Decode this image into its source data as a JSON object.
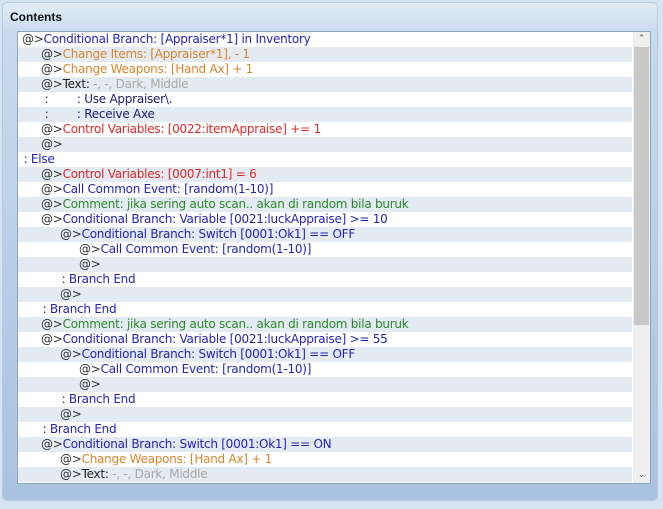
{
  "panel": {
    "title": "Contents"
  },
  "scrollbar": {
    "up_icon": "▲",
    "down_icon": "▼",
    "up_glyph": "⌃",
    "down_glyph": "⌄",
    "position_fraction": 0.0,
    "visible_fraction": 0.66
  },
  "rows": [
    {
      "level": 0,
      "prefix": "@>",
      "parts": [
        {
          "t": "Conditional Branch: [Appraiser*1] in Inventory",
          "c": "blue"
        }
      ]
    },
    {
      "level": 1,
      "prefix": "@>",
      "parts": [
        {
          "t": "Change Items: [Appraiser*1], - 1",
          "c": "orange"
        }
      ]
    },
    {
      "level": 1,
      "prefix": "@>",
      "parts": [
        {
          "t": "Change Weapons: [Hand Ax] + 1",
          "c": "orange"
        }
      ]
    },
    {
      "level": 1,
      "prefix": "@>",
      "parts": [
        {
          "t": "Text",
          "c": "black"
        },
        {
          "t": ": ",
          "c": "black"
        },
        {
          "t": "-, -, Dark, Middle",
          "c": "gray"
        }
      ]
    },
    {
      "level": 1,
      "cont": true,
      "prefix": " :",
      "parts": [
        {
          "t": "        : Use Appraiser\\.",
          "c": "navy"
        }
      ]
    },
    {
      "level": 1,
      "cont": true,
      "prefix": " :",
      "parts": [
        {
          "t": "        : Receive Axe",
          "c": "navy"
        }
      ]
    },
    {
      "level": 1,
      "prefix": "@>",
      "parts": [
        {
          "t": "Control Variables: [0022:itemAppraise] += 1",
          "c": "red"
        }
      ]
    },
    {
      "level": 1,
      "prefix": "@>",
      "parts": []
    },
    {
      "level": 0,
      "colon": true,
      "prefix": " : ",
      "parts": [
        {
          "t": "Else",
          "c": "blue"
        }
      ]
    },
    {
      "level": 1,
      "prefix": "@>",
      "parts": [
        {
          "t": "Control Variables: [0007:int1] = 6",
          "c": "red"
        }
      ]
    },
    {
      "level": 1,
      "prefix": "@>",
      "parts": [
        {
          "t": "Call Common Event: [random(1-10)]",
          "c": "blue"
        }
      ]
    },
    {
      "level": 1,
      "prefix": "@>",
      "parts": [
        {
          "t": "Comment: jika sering auto scan.. akan di random bila buruk",
          "c": "green"
        }
      ]
    },
    {
      "level": 1,
      "prefix": "@>",
      "parts": [
        {
          "t": "Conditional Branch: Variable [0021:luckAppraise] >= 10",
          "c": "blue"
        }
      ]
    },
    {
      "level": 2,
      "prefix": "@>",
      "parts": [
        {
          "t": "Conditional Branch: Switch [0001:Ok1] == OFF",
          "c": "blue"
        }
      ]
    },
    {
      "level": 3,
      "prefix": "@>",
      "parts": [
        {
          "t": "Call Common Event: [random(1-10)]",
          "c": "blue"
        }
      ]
    },
    {
      "level": 3,
      "prefix": "@>",
      "parts": []
    },
    {
      "level": 2,
      "colon": true,
      "prefix": " : ",
      "parts": [
        {
          "t": "Branch End",
          "c": "blue"
        }
      ]
    },
    {
      "level": 2,
      "prefix": "@>",
      "parts": []
    },
    {
      "level": 1,
      "colon": true,
      "prefix": " : ",
      "parts": [
        {
          "t": "Branch End",
          "c": "blue"
        }
      ]
    },
    {
      "level": 1,
      "prefix": "@>",
      "parts": [
        {
          "t": "Comment: jika sering auto scan.. akan di random bila buruk",
          "c": "green"
        }
      ]
    },
    {
      "level": 1,
      "prefix": "@>",
      "parts": [
        {
          "t": "Conditional Branch: Variable [0021:luckAppraise] >= 55",
          "c": "blue"
        }
      ]
    },
    {
      "level": 2,
      "prefix": "@>",
      "parts": [
        {
          "t": "Conditional Branch: Switch [0001:Ok1] == OFF",
          "c": "blue"
        }
      ]
    },
    {
      "level": 3,
      "prefix": "@>",
      "parts": [
        {
          "t": "Call Common Event: [random(1-10)]",
          "c": "blue"
        }
      ]
    },
    {
      "level": 3,
      "prefix": "@>",
      "parts": []
    },
    {
      "level": 2,
      "colon": true,
      "prefix": " : ",
      "parts": [
        {
          "t": "Branch End",
          "c": "blue"
        }
      ]
    },
    {
      "level": 2,
      "prefix": "@>",
      "parts": []
    },
    {
      "level": 1,
      "colon": true,
      "prefix": " : ",
      "parts": [
        {
          "t": "Branch End",
          "c": "blue"
        }
      ]
    },
    {
      "level": 1,
      "prefix": "@>",
      "parts": [
        {
          "t": "Conditional Branch: Switch [0001:Ok1] == ON",
          "c": "blue"
        }
      ]
    },
    {
      "level": 2,
      "prefix": "@>",
      "parts": [
        {
          "t": "Change Weapons: [Hand Ax] + 1",
          "c": "orange"
        }
      ]
    },
    {
      "level": 2,
      "prefix": "@>",
      "parts": [
        {
          "t": "Text",
          "c": "black"
        },
        {
          "t": ": ",
          "c": "black"
        },
        {
          "t": "-, -, Dark, Middle",
          "c": "gray"
        }
      ]
    }
  ]
}
